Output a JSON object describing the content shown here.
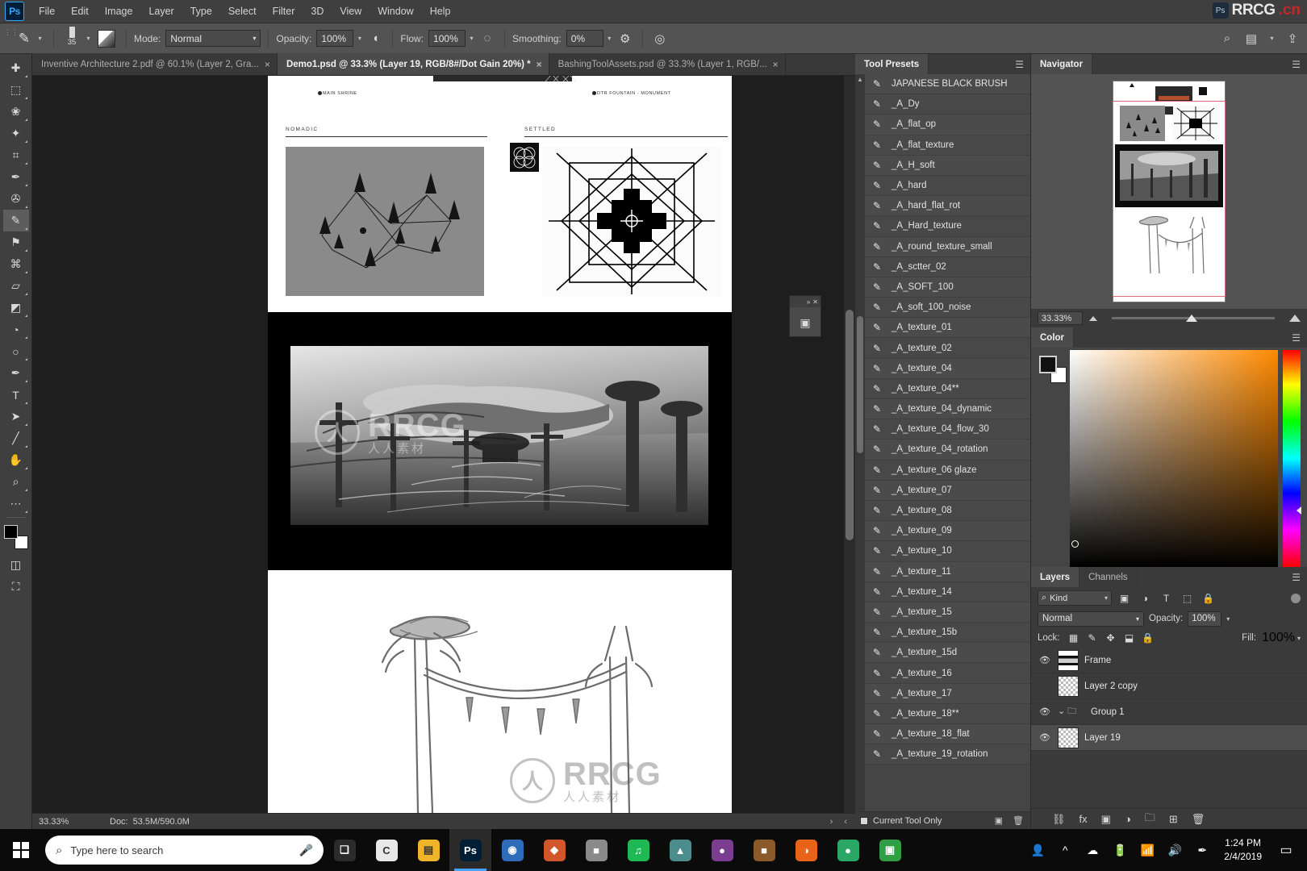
{
  "app": {
    "name": "Adobe Photoshop",
    "logo_text": "Ps"
  },
  "menubar": {
    "items": [
      "File",
      "Edit",
      "Image",
      "Layer",
      "Type",
      "Select",
      "Filter",
      "3D",
      "View",
      "Window",
      "Help"
    ],
    "watermark_text": "RRCG",
    "watermark_suffix": ".cn"
  },
  "options_bar": {
    "brush_size": "35",
    "mode_label": "Mode:",
    "mode_value": "Normal",
    "opacity_label": "Opacity:",
    "opacity_value": "100%",
    "flow_label": "Flow:",
    "flow_value": "100%",
    "smoothing_label": "Smoothing:",
    "smoothing_value": "0%"
  },
  "tabs": [
    {
      "label": "Inventive Architecture 2.pdf @ 60.1% (Layer 2, Gra...",
      "active": false,
      "close": "×"
    },
    {
      "label": "Demo1.psd @ 33.3% (Layer 19, RGB/8#/Dot Gain 20%) *",
      "active": true,
      "close": "×"
    },
    {
      "label": "BashingToolAssets.psd @ 33.3% (Layer 1, RGB/...",
      "active": false,
      "close": "×"
    }
  ],
  "toolbar": {
    "tools": [
      {
        "name": "move-tool",
        "glyph": "✚",
        "selected": false
      },
      {
        "name": "marquee-tool",
        "glyph": "⬚",
        "selected": false
      },
      {
        "name": "lasso-tool",
        "glyph": "❀",
        "selected": false
      },
      {
        "name": "quick-selection-tool",
        "glyph": "✦",
        "selected": false
      },
      {
        "name": "crop-tool",
        "glyph": "⌗",
        "selected": false
      },
      {
        "name": "eyedropper-tool",
        "glyph": "✒",
        "selected": false
      },
      {
        "name": "healing-brush-tool",
        "glyph": "✇",
        "selected": false
      },
      {
        "name": "brush-tool",
        "glyph": "✎",
        "selected": true
      },
      {
        "name": "clone-stamp-tool",
        "glyph": "⚑",
        "selected": false
      },
      {
        "name": "history-brush-tool",
        "glyph": "⌘",
        "selected": false
      },
      {
        "name": "eraser-tool",
        "glyph": "▱",
        "selected": false
      },
      {
        "name": "gradient-tool",
        "glyph": "◩",
        "selected": false
      },
      {
        "name": "blur-tool",
        "glyph": "◔",
        "selected": false
      },
      {
        "name": "dodge-tool",
        "glyph": "○",
        "selected": false
      },
      {
        "name": "pen-tool",
        "glyph": "✒",
        "selected": false
      },
      {
        "name": "type-tool",
        "glyph": "T",
        "selected": false
      },
      {
        "name": "path-selection-tool",
        "glyph": "➤",
        "selected": false
      },
      {
        "name": "line-tool",
        "glyph": "╱",
        "selected": false
      },
      {
        "name": "hand-tool",
        "glyph": "✋",
        "selected": false
      },
      {
        "name": "zoom-tool",
        "glyph": "⌕",
        "selected": false
      },
      {
        "name": "more-tools",
        "glyph": "⋯",
        "selected": false
      }
    ]
  },
  "canvas": {
    "page_sections": {
      "nomadic_label": "NOMADIC",
      "settled_label": "SETTLED",
      "main_shrine_label": "MAIN SHRINE",
      "fountain_label": "DTR FOUNTAIN - MONUMENT"
    },
    "watermark": {
      "initials": "人",
      "rrcg": "RRCG",
      "sub": "人人素材"
    }
  },
  "status_bar": {
    "zoom": "33.33%",
    "doc_label": "Doc:",
    "doc_value": "53.5M/590.0M",
    "nav_left": "›",
    "nav_right": "‹"
  },
  "tool_presets": {
    "tab_label": "Tool Presets",
    "items": [
      "JAPANESE BLACK BRUSH",
      "_A_Dy",
      "_A_flat_op",
      "_A_flat_texture",
      "_A_H_soft",
      "_A_hard",
      "_A_hard_flat_rot",
      "_A_Hard_texture",
      "_A_round_texture_small",
      "_A_sctter_02",
      "_A_SOFT_100",
      "_A_soft_100_noise",
      "_A_texture_01",
      "_A_texture_02",
      "_A_texture_04",
      "_A_texture_04**",
      "_A_texture_04_dynamic",
      "_A_texture_04_flow_30",
      "_A_texture_04_rotation",
      "_A_texture_06 glaze",
      "_A_texture_07",
      "_A_texture_08",
      "_A_texture_09",
      "_A_texture_10",
      "_A_texture_11",
      "_A_texture_14",
      "_A_texture_15",
      "_A_texture_15b",
      "_A_texture_15d",
      "_A_texture_16",
      "_A_texture_17",
      "_A_texture_18**",
      "_A_texture_18_flat",
      "_A_texture_19_rotation"
    ],
    "footer_checkbox_label": "Current Tool Only"
  },
  "navigator": {
    "tab_label": "Navigator",
    "zoom_value": "33.33%"
  },
  "color": {
    "tab_label": "Color",
    "foreground": "#111111",
    "background": "#ffffff",
    "accent_hue": "#ff8a00"
  },
  "layers": {
    "tabs": [
      {
        "label": "Layers",
        "active": true
      },
      {
        "label": "Channels",
        "active": false
      }
    ],
    "filter_kind": "Kind",
    "blend_mode": "Normal",
    "opacity_label": "Opacity:",
    "opacity_value": "100%",
    "lock_label": "Lock:",
    "fill_label": "Fill:",
    "fill_value": "100%",
    "rows": [
      {
        "name": "Frame",
        "visible": true,
        "selected": false,
        "type": "layer"
      },
      {
        "name": "Layer 2 copy",
        "visible": false,
        "selected": false,
        "type": "layer"
      },
      {
        "name": "Group 1",
        "visible": true,
        "selected": false,
        "type": "group"
      },
      {
        "name": "Layer 19",
        "visible": true,
        "selected": true,
        "type": "layer"
      }
    ]
  },
  "taskbar": {
    "search_placeholder": "Type here to search",
    "time": "1:24 PM",
    "date": "2/4/2019",
    "apps": [
      {
        "name": "task-view",
        "glyph": "❑",
        "color": "#2b2b2b",
        "active": false
      },
      {
        "name": "google-chrome",
        "glyph": "C",
        "color": "#e8e8e8",
        "active": false
      },
      {
        "name": "file-explorer",
        "glyph": "▤",
        "color": "#f0b429",
        "active": false
      },
      {
        "name": "photoshop",
        "glyph": "Ps",
        "color": "#001e36",
        "active": true
      },
      {
        "name": "app-blue",
        "glyph": "◉",
        "color": "#2e6bb8",
        "active": false
      },
      {
        "name": "app-orange",
        "glyph": "◆",
        "color": "#d2562a",
        "active": false
      },
      {
        "name": "app-gray",
        "glyph": "■",
        "color": "#8a8a8a",
        "active": false
      },
      {
        "name": "spotify",
        "glyph": "♫",
        "color": "#1db954",
        "active": false
      },
      {
        "name": "app-teal",
        "glyph": "▲",
        "color": "#4c8c8c",
        "active": false
      },
      {
        "name": "app-purple",
        "glyph": "●",
        "color": "#7a3d8f",
        "active": false
      },
      {
        "name": "app-brown",
        "glyph": "■",
        "color": "#8b5a2b",
        "active": false
      },
      {
        "name": "firefox",
        "glyph": "◑",
        "color": "#e8621a",
        "active": false
      },
      {
        "name": "app-green",
        "glyph": "●",
        "color": "#2aa765",
        "active": false
      },
      {
        "name": "app-green2",
        "glyph": "▣",
        "color": "#2f9e44",
        "active": false
      }
    ],
    "tray": [
      "people-icon",
      "chevron-up-icon",
      "onedrive-icon",
      "battery-icon",
      "wifi-icon",
      "volume-icon",
      "pen-icon"
    ],
    "action_center": "⬜"
  }
}
